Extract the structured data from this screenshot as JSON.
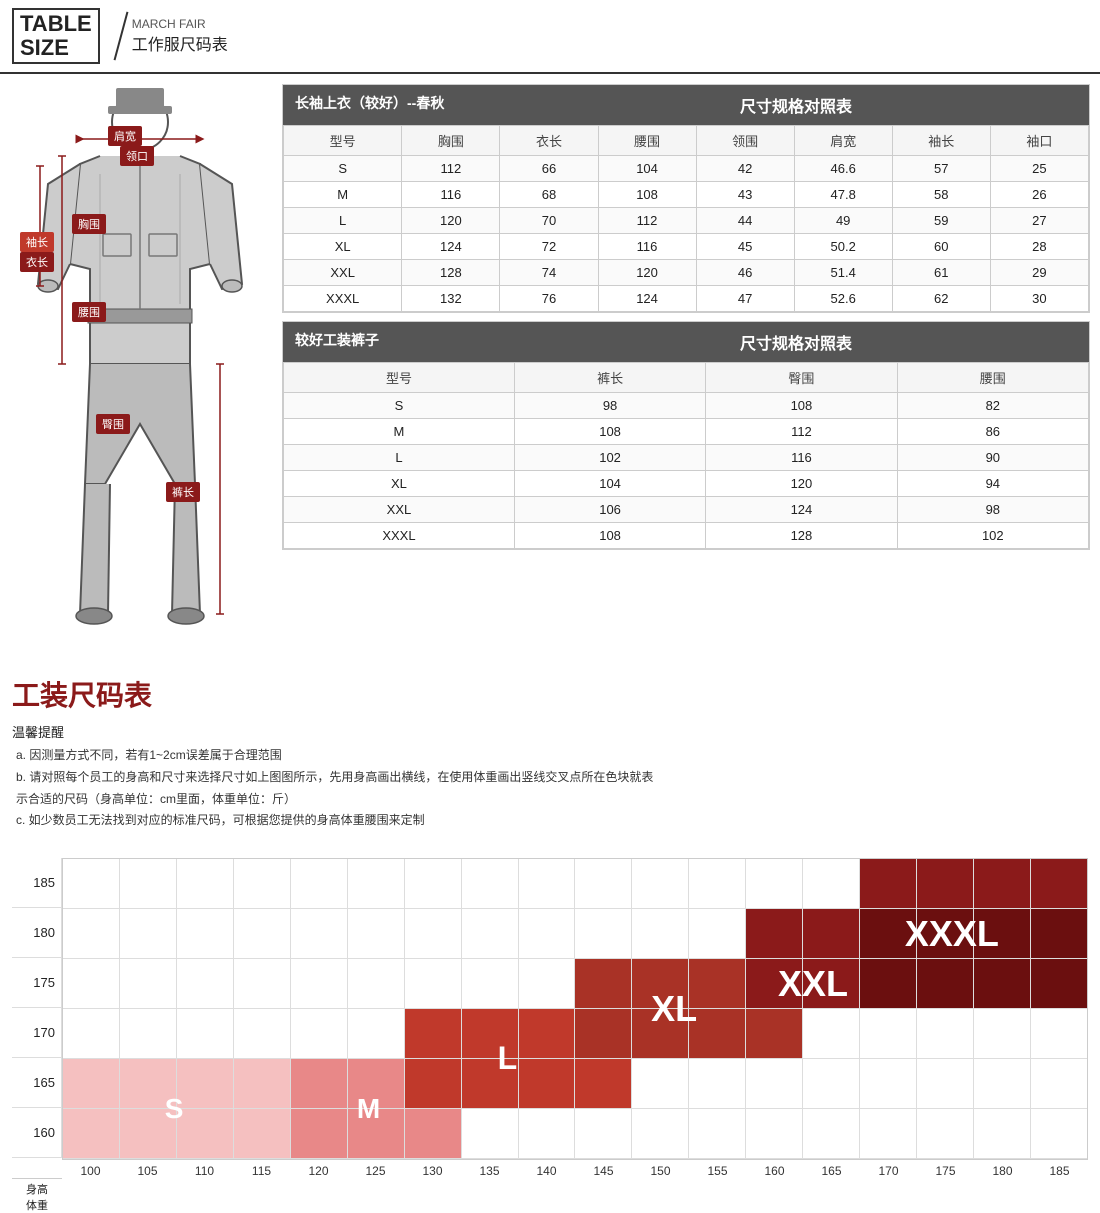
{
  "header": {
    "table_label": "TABLE",
    "size_label": "SIZE",
    "brand": "MARCH FAIR",
    "subtitle": "工作服尺码表"
  },
  "upper_table": {
    "section_title": "长袖上衣（较好）--春秋",
    "section_spec": "尺寸规格对照表",
    "columns": [
      "型号",
      "胸围",
      "衣长",
      "腰围",
      "领围",
      "肩宽",
      "袖长",
      "袖口"
    ],
    "rows": [
      [
        "S",
        "112",
        "66",
        "104",
        "42",
        "46.6",
        "57",
        "25"
      ],
      [
        "M",
        "116",
        "68",
        "108",
        "43",
        "47.8",
        "58",
        "26"
      ],
      [
        "L",
        "120",
        "70",
        "112",
        "44",
        "49",
        "59",
        "27"
      ],
      [
        "XL",
        "124",
        "72",
        "116",
        "45",
        "50.2",
        "60",
        "28"
      ],
      [
        "XXL",
        "128",
        "74",
        "120",
        "46",
        "51.4",
        "61",
        "29"
      ],
      [
        "XXXL",
        "132",
        "76",
        "124",
        "47",
        "52.6",
        "62",
        "30"
      ]
    ]
  },
  "lower_table": {
    "section_title": "较好工装裤子",
    "section_spec": "尺寸规格对照表",
    "columns": [
      "型号",
      "裤长",
      "臀围",
      "腰围"
    ],
    "rows": [
      [
        "S",
        "98",
        "108",
        "82"
      ],
      [
        "M",
        "108",
        "112",
        "86"
      ],
      [
        "L",
        "102",
        "116",
        "90"
      ],
      [
        "XL",
        "104",
        "120",
        "94"
      ],
      [
        "XXL",
        "106",
        "124",
        "98"
      ],
      [
        "XXXL",
        "108",
        "128",
        "102"
      ]
    ]
  },
  "figure_labels": {
    "shoulder_width": "肩宽",
    "collar": "领口",
    "chest": "胸围",
    "clothing_length": "衣长",
    "sleeve_length": "袖长",
    "waist": "腰围",
    "hip": "臀围",
    "pants_length": "裤长"
  },
  "bottom_title": "工装尺码表",
  "reminder": {
    "title": "温馨提醒",
    "items": [
      "a. 因测量方式不同，若有1~2cm误差属于合理范围",
      "b. 请对照每个员工的身高和尺寸来选择尺寸如上图图所示，先用身高画出横线，在使用体重画出竖线交叉点所在色块就表\n    示合适的尺码（身高单位：cm里面，体重单位：斤）",
      "c. 如少数员工无法找到对应的标准尺码，可根据您提供的身高体重腰围来定制"
    ]
  },
  "size_chart": {
    "y_labels": [
      "185",
      "180",
      "175",
      "170",
      "165",
      "160"
    ],
    "x_labels": [
      "100",
      "105",
      "110",
      "115",
      "120",
      "125",
      "130",
      "135",
      "140",
      "145",
      "150",
      "155",
      "160",
      "165",
      "170",
      "175",
      "180",
      "185"
    ],
    "y_axis_bottom": "身高",
    "x_axis_bottom": "体重",
    "sizes": [
      "S",
      "M",
      "L",
      "XL",
      "XXL",
      "XXXL"
    ]
  }
}
